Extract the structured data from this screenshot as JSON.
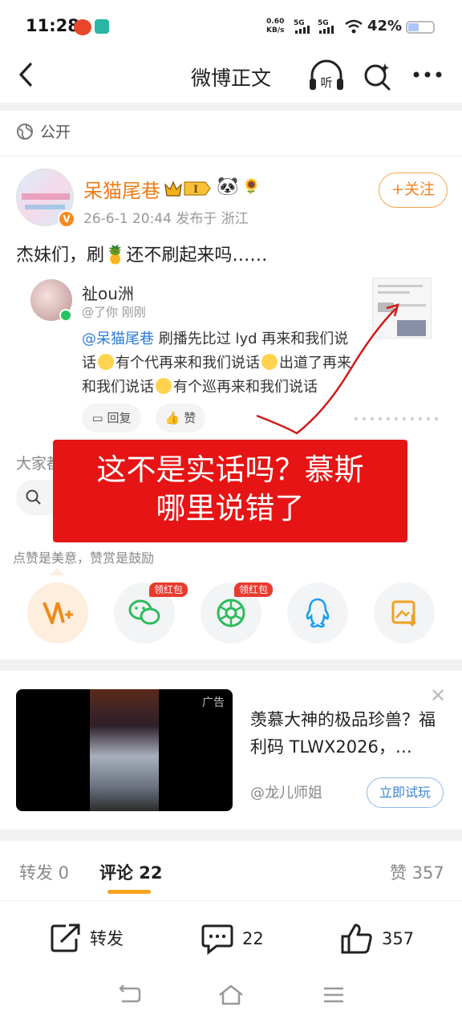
{
  "status_bar": {
    "time": "11:28",
    "netspeed_value": "0.60",
    "netspeed_unit": "KB/s",
    "sim1": "5G",
    "sim2": "5G",
    "battery": "42%",
    "battery_level": 0.42
  },
  "nav": {
    "title": "微博正文"
  },
  "visibility": "公开",
  "post": {
    "username": "呆猫尾巷",
    "crown_level": "I",
    "meta": "26-6-1 20:44  发布于 浙江",
    "follow_label": "+关注",
    "text": "杰妹们，刷🍍还不刷起来吗……"
  },
  "quote": {
    "name": "祉ou洲",
    "meta": "@了你   刚刚",
    "mention": "@呆猫尾巷",
    "segments": [
      "刷播先比过 lyd 再来和我们说话",
      "有个代再来和我们说话",
      "出道了再来和我们说话",
      "有个巡再来和我们说话"
    ],
    "reply_label": "回复",
    "like_label": "赞"
  },
  "comment_prompt": "大家都",
  "overlay_text": [
    "这不是实话吗？慕斯",
    "哪里说错了"
  ],
  "like_hint": "点赞是美意，赞赏是鼓励",
  "share": {
    "red_tag_1": "领红包",
    "red_tag_2": "领红包"
  },
  "ad": {
    "tag": "广告",
    "title": "羡慕大神的极品珍兽？福利码 TLWX2026，…",
    "author": "@龙儿师姐",
    "button": "立即试玩"
  },
  "tabs": {
    "repost": "转发 0",
    "comment": "评论 22",
    "like": "赞 357"
  },
  "actions": {
    "repost": "转发",
    "comment": "22",
    "like": "357"
  },
  "colors": {
    "accent": "#f7821f",
    "link": "#2b7bd6",
    "overlay": "#e61414"
  }
}
